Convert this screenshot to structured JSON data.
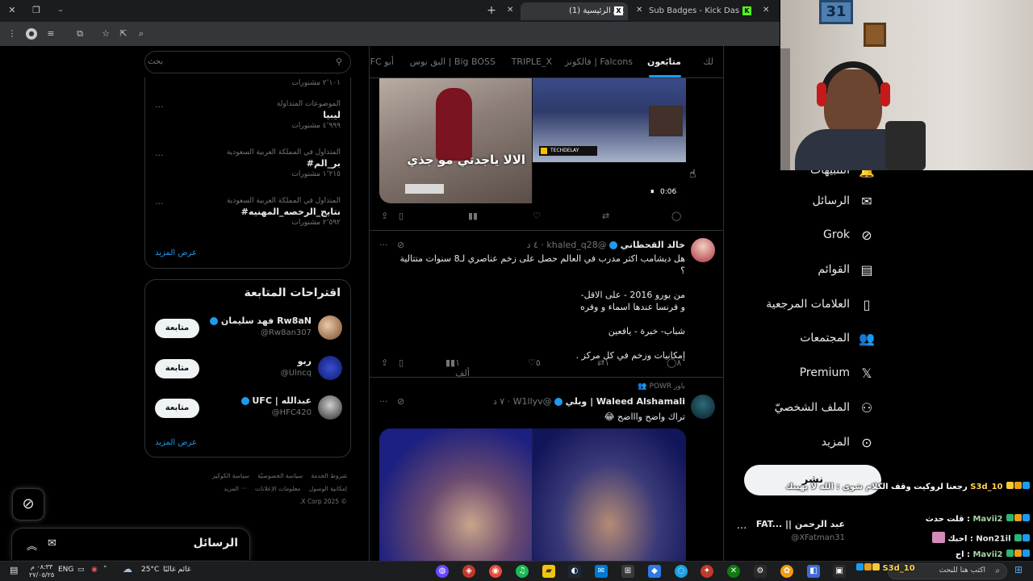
{
  "browser": {
    "tabs": [
      {
        "title": "(1) الرئيسية / X",
        "active": true
      },
      {
        "title": "Sub Badges - Kick Dashboard",
        "active": false
      }
    ],
    "new_tab": "+"
  },
  "feed_tabs": [
    "لك",
    "متابَعون",
    "فالكونز | Falcons",
    "TRIPLE_X",
    "البق بوس | Big BOSS",
    "FC أبو"
  ],
  "search": {
    "placeholder": "بحث"
  },
  "trends": {
    "top_count": "٢٬١٠١ مشنورات",
    "items": [
      {
        "context": "الموضوعات المتداولة",
        "name": "ليبيا",
        "count": "٤٬٩٩٩ مشنورات"
      },
      {
        "context": "المتداول في المملكة العربية السعودية",
        "name": "#بر_الم",
        "count": "١٬٢١٥ مشنورات"
      },
      {
        "context": "المتداول في المملكة العربية السعودية",
        "name": "#نتايج_الرخصه_المهنيه",
        "count": "٢٬٥٩٢ مشنورات"
      }
    ],
    "show_more": "عرض المزيد"
  },
  "who_to_follow": {
    "title": "اقتراحات المتابعة",
    "items": [
      {
        "name": "فهد سليمان Rw8aN",
        "handle": "@Rw8an307",
        "button": "متابعة"
      },
      {
        "name": "ربو",
        "handle": "@Ulncq",
        "button": "متابعة"
      },
      {
        "name": "UFC | عبدالله",
        "handle": "@HFC420",
        "button": "متابعة"
      }
    ],
    "show_more": "عرض المزيد"
  },
  "footer": {
    "links": [
      "شروط الخدمة",
      "سياسة الخصوصيّة",
      "سياسة الكوكيز",
      "إمكانية الوصول",
      "معلومات الإعلانات",
      "··· المزيد"
    ],
    "copyright": "© 2025 X Corp."
  },
  "messages_drawer": {
    "title": "الرسائل"
  },
  "tweets": [
    {
      "media_overlay": "الالا ياجدتي مو جذي",
      "media_channel": "TECHDELAY",
      "video_time": "0:06"
    },
    {
      "name": "خالد القحطاني",
      "handle": "@khaled_q28",
      "time": "٤ د",
      "lines": [
        "هل ديشامب اكثر مدرب في العالم حصل على زخم عناصري لـ8 سنوات متتالية ؟",
        "",
        "من يورو 2016 - على الاقل-",
        "و فرنسا عندها اسماء و وفره",
        "",
        "شباب- خبرة - يافعين",
        "",
        "إمكانيات وزخم في كل مركز ."
      ],
      "stats": {
        "replies": "٨",
        "reposts": "١",
        "likes": "٥",
        "views": "١ ألف"
      }
    },
    {
      "social_context": "باور POWR",
      "name": "Waleed Alshamali | وبلي",
      "handle": "@W1llyv",
      "time": "٧ د",
      "text": "تراك واضح واااضح 😂"
    }
  ],
  "nav": {
    "items": [
      {
        "label": "التنبيهات",
        "icon": "bell-icon"
      },
      {
        "label": "الرسائل",
        "icon": "mail-icon"
      },
      {
        "label": "Grok",
        "icon": "grok-icon"
      },
      {
        "label": "القوائم",
        "icon": "list-icon"
      },
      {
        "label": "العلامات المرجعية",
        "icon": "bookmark-icon"
      },
      {
        "label": "المجتمعات",
        "icon": "communities-icon"
      },
      {
        "label": "Premium",
        "icon": "x-logo-icon"
      },
      {
        "label": "الملف الشخصيّ",
        "icon": "profile-icon"
      },
      {
        "label": "المزيد",
        "icon": "more-icon"
      }
    ],
    "post_button": "نشر"
  },
  "account": {
    "name": "FAT... || عبد الرحمن",
    "handle": "@XFatman31"
  },
  "chat": [
    {
      "user": "S3d_10",
      "color": "#ffd54f",
      "msg": "رجعنا لروكيت وقف الكلام شوي : الله لا يهينك"
    },
    {
      "user": "Mavii2",
      "color": "#a5d6a7",
      "msg": "قلت حدث :"
    },
    {
      "user": "Non21il",
      "color": "#e7e9ea",
      "msg": "احبك :"
    },
    {
      "user": "Mavii2",
      "color": "#a5d6a7",
      "msg": "اح :"
    },
    {
      "user": "S3d_10",
      "color": "#ffd54f",
      "msg": ""
    }
  ],
  "taskbar": {
    "weather": "25°C",
    "weather_text": "غائم غالبًا",
    "lang": "ENG",
    "time": "٠٨:٣٣ م",
    "date": "٢٧/٠٥/٢٥",
    "search_placeholder": "اكتب هنا للبحث"
  }
}
